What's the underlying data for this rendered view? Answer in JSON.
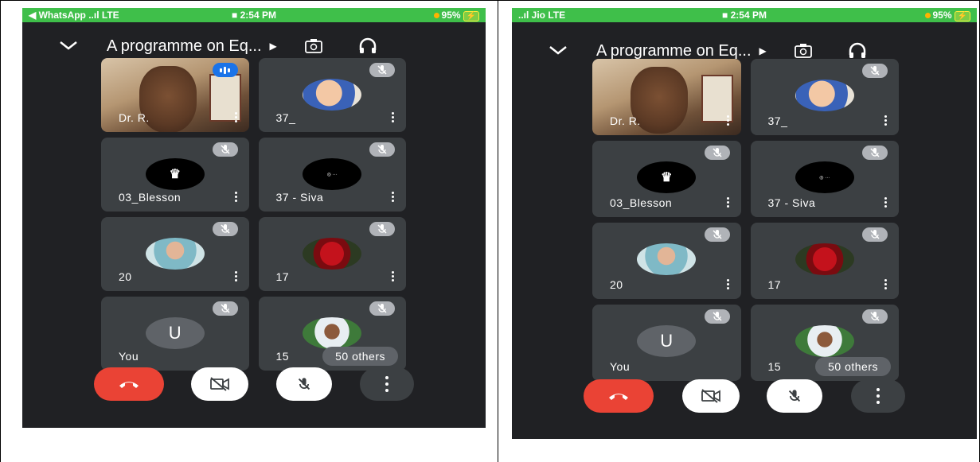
{
  "phones": [
    {
      "status": {
        "left": "◀ WhatsApp ..ıl LTE",
        "time": "■ 2:54 PM",
        "battery": "95%"
      },
      "meeting_title": "A programme on Eq...",
      "tiles": [
        {
          "name": "Dr. R.",
          "kind": "video",
          "speaking": true
        },
        {
          "name": "37_",
          "kind": "avatar",
          "avatar": "baby-photo",
          "muted": true
        },
        {
          "name": "03_Blesson",
          "kind": "avatar",
          "avatar": "bm-logo",
          "muted": true
        },
        {
          "name": "37 - Siva",
          "kind": "avatar",
          "avatar": "solo-siva-logo",
          "muted": true
        },
        {
          "name": "20",
          "kind": "avatar",
          "avatar": "person-photo",
          "muted": true
        },
        {
          "name": "17",
          "kind": "avatar",
          "avatar": "rose-photo",
          "muted": true
        },
        {
          "name": "You",
          "kind": "initial",
          "initial": "U",
          "muted": true
        },
        {
          "name": "15",
          "kind": "avatar",
          "avatar": "person-photo-2",
          "muted": true,
          "others": "50 others"
        }
      ]
    },
    {
      "status": {
        "left": "..ıl Jio  LTE",
        "time": "■ 2:54 PM",
        "battery": "95%"
      },
      "meeting_title": "A programme on Eq...",
      "tiles": [
        {
          "name": "Dr. R.",
          "kind": "video",
          "speaking": false
        },
        {
          "name": "37_",
          "kind": "avatar",
          "avatar": "baby-photo",
          "muted": true
        },
        {
          "name": "03_Blesson",
          "kind": "avatar",
          "avatar": "bm-logo",
          "muted": true
        },
        {
          "name": "37 - Siva",
          "kind": "avatar",
          "avatar": "solo-siva-logo",
          "muted": true
        },
        {
          "name": "20",
          "kind": "avatar",
          "avatar": "person-photo",
          "muted": true
        },
        {
          "name": "17",
          "kind": "avatar",
          "avatar": "rose-photo",
          "muted": true
        },
        {
          "name": "You",
          "kind": "initial",
          "initial": "U",
          "muted": true
        },
        {
          "name": "15",
          "kind": "avatar",
          "avatar": "person-photo-2",
          "muted": true,
          "others": "50 others"
        }
      ]
    }
  ],
  "logo_text": {
    "bm": "BM",
    "solo_siva": "SOLO SIVA"
  },
  "colors": {
    "statusbar": "#3fbf4a",
    "background": "#202124",
    "tile": "#3c4043",
    "hangup": "#ea4335",
    "speaking": "#1a73e8"
  }
}
